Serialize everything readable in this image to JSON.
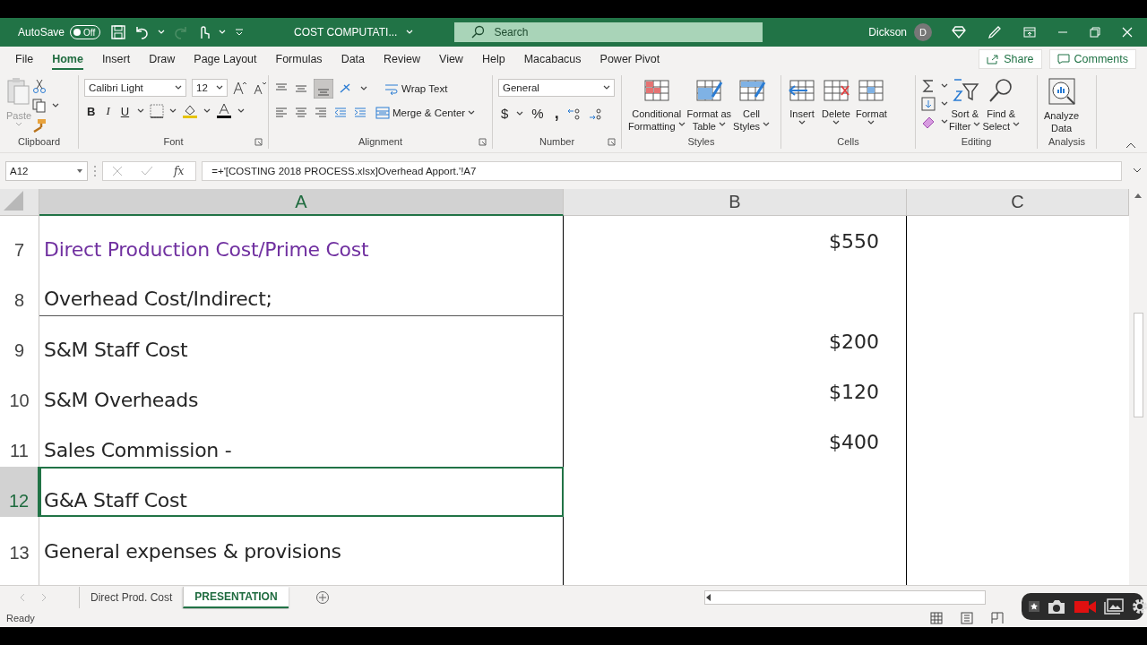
{
  "title_bar": {
    "autosave_label": "AutoSave",
    "autosave_state": "Off",
    "autosave_on": false,
    "file_name": "COST COMPUTATI...",
    "search_placeholder": "Search",
    "user_name": "Dickson",
    "user_initial": "D"
  },
  "menu_tabs": [
    {
      "label": "File",
      "selected": false
    },
    {
      "label": "Home",
      "selected": true
    },
    {
      "label": "Insert",
      "selected": false
    },
    {
      "label": "Draw",
      "selected": false
    },
    {
      "label": "Page Layout",
      "selected": false
    },
    {
      "label": "Formulas",
      "selected": false
    },
    {
      "label": "Data",
      "selected": false
    },
    {
      "label": "Review",
      "selected": false
    },
    {
      "label": "View",
      "selected": false
    },
    {
      "label": "Help",
      "selected": false
    },
    {
      "label": "Macabacus",
      "selected": false
    },
    {
      "label": "Power Pivot",
      "selected": false
    }
  ],
  "share_button": "Share",
  "comments_button": "Comments",
  "ribbon": {
    "clipboard": {
      "paste": "Paste",
      "group": "Clipboard"
    },
    "font": {
      "font_name": "Calibri Light",
      "font_size": "12",
      "bold": "B",
      "italic": "I",
      "underline": "U",
      "group": "Font"
    },
    "alignment": {
      "wrap_text": "Wrap Text",
      "merge_center": "Merge & Center",
      "group": "Alignment"
    },
    "number": {
      "format": "General",
      "currency": "$",
      "percent": "%",
      "comma": ",",
      "group": "Number"
    },
    "styles": {
      "buttons": [
        {
          "lines": [
            "Conditional",
            "Formatting"
          ],
          "dropdown": true
        },
        {
          "lines": [
            "Format as",
            "Table"
          ],
          "dropdown": true
        },
        {
          "lines": [
            "Cell",
            "Styles"
          ],
          "dropdown": true
        }
      ],
      "group": "Styles"
    },
    "cells": {
      "buttons": [
        {
          "lines": [
            "Insert"
          ],
          "dropdown": true
        },
        {
          "lines": [
            "Delete"
          ],
          "dropdown": true
        },
        {
          "lines": [
            "Format"
          ],
          "dropdown": true
        }
      ],
      "group": "Cells"
    },
    "editing": {
      "buttons": [
        {
          "lines": [
            "Sort &",
            "Filter"
          ],
          "dropdown": true
        },
        {
          "lines": [
            "Find &",
            "Select"
          ],
          "dropdown": true
        }
      ],
      "group": "Editing"
    },
    "analysis": {
      "buttons": [
        {
          "lines": [
            "Analyze",
            "Data"
          ],
          "dropdown": false
        }
      ],
      "group": "Analysis"
    }
  },
  "formula_bar": {
    "name_box": "A12",
    "fx": "fx",
    "formula": "=+'[COSTING 2018 PROCESS.xlsx]Overhead Apport.'!A7"
  },
  "columns": [
    {
      "label": "A",
      "selected": true
    },
    {
      "label": "B",
      "selected": false
    },
    {
      "label": "C",
      "selected": false
    }
  ],
  "rows": [
    {
      "number": "7",
      "a": "Direct Production Cost/Prime Cost",
      "b": "$550",
      "color": "#7030a0",
      "selected": false,
      "bottom_border": false
    },
    {
      "number": "8",
      "a": "Overhead Cost/Indirect;",
      "color": "#262626",
      "selected": false,
      "bottom_border": true
    },
    {
      "number": "9",
      "a": "S&M Staff Cost",
      "b": "$200",
      "color": "#262626",
      "selected": false,
      "bottom_border": false
    },
    {
      "number": "10",
      "a": "S&M Overheads",
      "b": "$120",
      "color": "#262626",
      "selected": false,
      "bottom_border": false
    },
    {
      "number": "11",
      "a": "Sales Commission -",
      "b": "$400",
      "color": "#262626",
      "selected": false,
      "bottom_border": false
    },
    {
      "number": "12",
      "a": "G&A Staff Cost",
      "color": "#262626",
      "selected": true,
      "bottom_border": false
    },
    {
      "number": "13",
      "a": "General expenses & provisions",
      "color": "#262626",
      "selected": false,
      "bottom_border": false
    }
  ],
  "sheet_tabs": [
    {
      "label": "Direct Prod. Cost",
      "selected": false
    },
    {
      "label": "PRESENTATION",
      "selected": true
    }
  ],
  "status_bar": {
    "status": "Ready"
  }
}
